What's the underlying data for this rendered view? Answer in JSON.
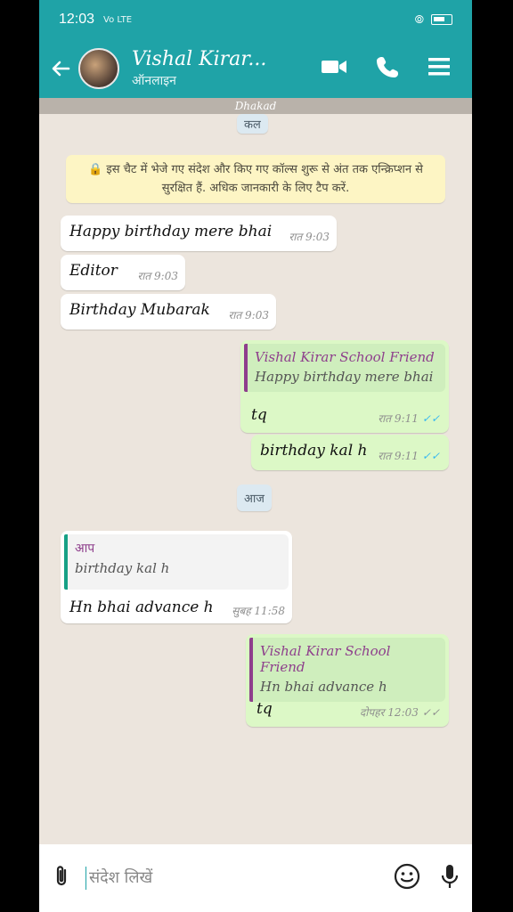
{
  "status_bar": {
    "time": "12:03",
    "network": "Vo LTE"
  },
  "header": {
    "contact_name": "Vishal Kirar...",
    "contact_status": "ऑनलाइन",
    "icons": [
      "back-arrow-icon",
      "video-call-icon",
      "phone-icon",
      "menu-icon"
    ]
  },
  "banner": {
    "text": "Dhakad"
  },
  "dates": {
    "yesterday": "कल",
    "today": "आज"
  },
  "encryption_notice": "इस चैट में भेजे गए संदेश और किए गए कॉल्स शुरू से अंत तक एन्क्रिप्शन से सुरक्षित हैं. अधिक जानकारी के लिए टैप करें.",
  "messages": [
    {
      "text": "Happy birthday mere bhai",
      "time": "रात 9:03"
    },
    {
      "text": "Editor",
      "time": "रात 9:03"
    },
    {
      "text": "Birthday Mubarak",
      "time": "रात 9:03"
    },
    {
      "quote_name": "Vishal Kirar School Friend",
      "quote_text": "Happy birthday mere bhai",
      "text": "tq",
      "time": "रात 9:11"
    },
    {
      "text": "birthday kal h",
      "time": "रात 9:11"
    },
    {
      "quote_name": "आप",
      "quote_text": "birthday kal h",
      "text": "Hn bhai advance h",
      "time": "सुबह 11:58"
    },
    {
      "quote_name": "Vishal Kirar School Friend",
      "quote_text": "Hn bhai advance h",
      "text": "tq",
      "time": "दोपहर 12:03"
    }
  ],
  "composer": {
    "placeholder": "संदेश लिखें"
  },
  "colors": {
    "primary": "#1fa3a7",
    "outgoing_bubble": "#dcf8c6",
    "incoming_bubble": "#ffffff",
    "quote_purple": "#8e3f8c",
    "quote_green": "#16a085",
    "read_tick": "#34b7f1"
  }
}
